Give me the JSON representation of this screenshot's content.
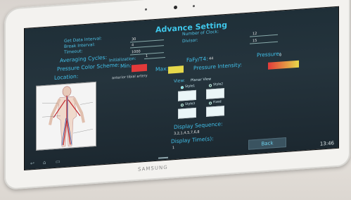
{
  "screen": {
    "title": "Advance Setting",
    "left_labels": [
      "Get Data Interval:",
      "Break Interval:",
      "Timeout:",
      "Averaging Cycles:",
      "Pressure Color Scheme:",
      "Location:"
    ],
    "left_values": [
      "30",
      "4",
      "1000"
    ],
    "right_labels": [
      "Number of Clock:",
      "Divisor:"
    ],
    "right_values": [
      "12",
      "15"
    ],
    "initialization_label": "Initialization:",
    "initialization_value": "1",
    "min_label": "Min:",
    "max_label": "Max:",
    "fa_label": "FaFy/T4:",
    "fa_value": "44",
    "pressure_label": "Pressure:",
    "pressure_value": "0",
    "pressure_intensity_label": "Pressure Intensity:",
    "location_value": "anterior tibial artery",
    "view_label": "View:",
    "view_value": "Planar View",
    "presets": [
      "Style1",
      "Style2",
      "Style3",
      "Fixed"
    ],
    "display_sequence_label": "Display Sequence:",
    "display_sequence_value": "3,2,1,4,5,7,6,8",
    "display_time_label": "Display Time(s):",
    "display_time_value": "1",
    "back_button": "Back",
    "clock": "13:46",
    "brand": "SAMSUNG",
    "colors": {
      "min": "#e23a3a",
      "max": "#e6d84a",
      "accent": "#3fc7ea"
    }
  }
}
